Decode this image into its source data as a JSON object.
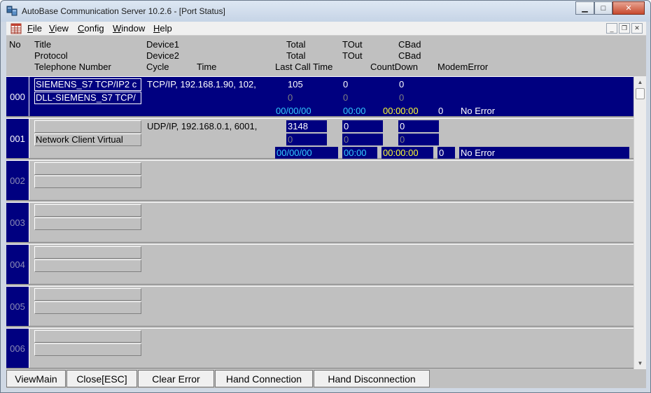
{
  "window": {
    "title": "AutoBase Communication Server 10.2.6 - [Port Status]"
  },
  "caption_buttons": {
    "minimize": "▁",
    "maximize": "□",
    "close": "✕"
  },
  "menu": [
    {
      "accel": "F",
      "rest": "ile"
    },
    {
      "accel": "V",
      "rest": "iew"
    },
    {
      "accel": "C",
      "rest": "onfig"
    },
    {
      "accel": "W",
      "rest": "indow"
    },
    {
      "accel": "H",
      "rest": "elp"
    }
  ],
  "mdi_buttons": {
    "minimize": "_",
    "restore": "❐",
    "close": "✕"
  },
  "header": {
    "no": "No",
    "title": "Title",
    "protocol": "Protocol",
    "telephone": "Telephone Number",
    "device1": "Device1",
    "device2": "Device2",
    "cycle": "Cycle",
    "time": "Time",
    "total1": "Total",
    "total2": "Total",
    "last_call_time": "Last Call Time",
    "tout1": "TOut",
    "tout2": "TOut",
    "cbad1": "CBad",
    "cbad2": "CBad",
    "countdown": "CountDown",
    "modemerror": "ModemError"
  },
  "rows": [
    {
      "no": "000",
      "title": "SIEMENS_S7 TCP/IP2 c",
      "protocol": "DLL-SIEMENS_S7 TCP/",
      "device": "TCP/IP, 192.168.1.90, 102,",
      "total": "105",
      "total2": "0",
      "tout": "0",
      "tout2": "0",
      "cbad": "0",
      "cbad2": "0",
      "last_call_time": "00/00/00",
      "time": "00:00",
      "countdown": "00:00:00",
      "modem_code": "0",
      "modem_error": "No Error"
    },
    {
      "no": "001",
      "title": "",
      "protocol": "Network Client Virtual",
      "device": "UDP/IP, 192.168.0.1, 6001,",
      "total": "3148",
      "total2": "0",
      "tout": "0",
      "tout2": "0",
      "cbad": "0",
      "cbad2": "0",
      "last_call_time": "00/00/00",
      "time": "00:00",
      "countdown": "00:00:00",
      "modem_code": "0",
      "modem_error": "No Error"
    },
    {
      "no": "002"
    },
    {
      "no": "003"
    },
    {
      "no": "004"
    },
    {
      "no": "005"
    },
    {
      "no": "006"
    }
  ],
  "scrollbar": {
    "up": "▲",
    "down": "▼"
  },
  "buttons": {
    "viewmain": "ViewMain",
    "close": "Close[ESC]",
    "clear_error": "Clear Error",
    "hand_connection": "Hand Connection",
    "hand_disconnection": "Hand Disconnection"
  }
}
